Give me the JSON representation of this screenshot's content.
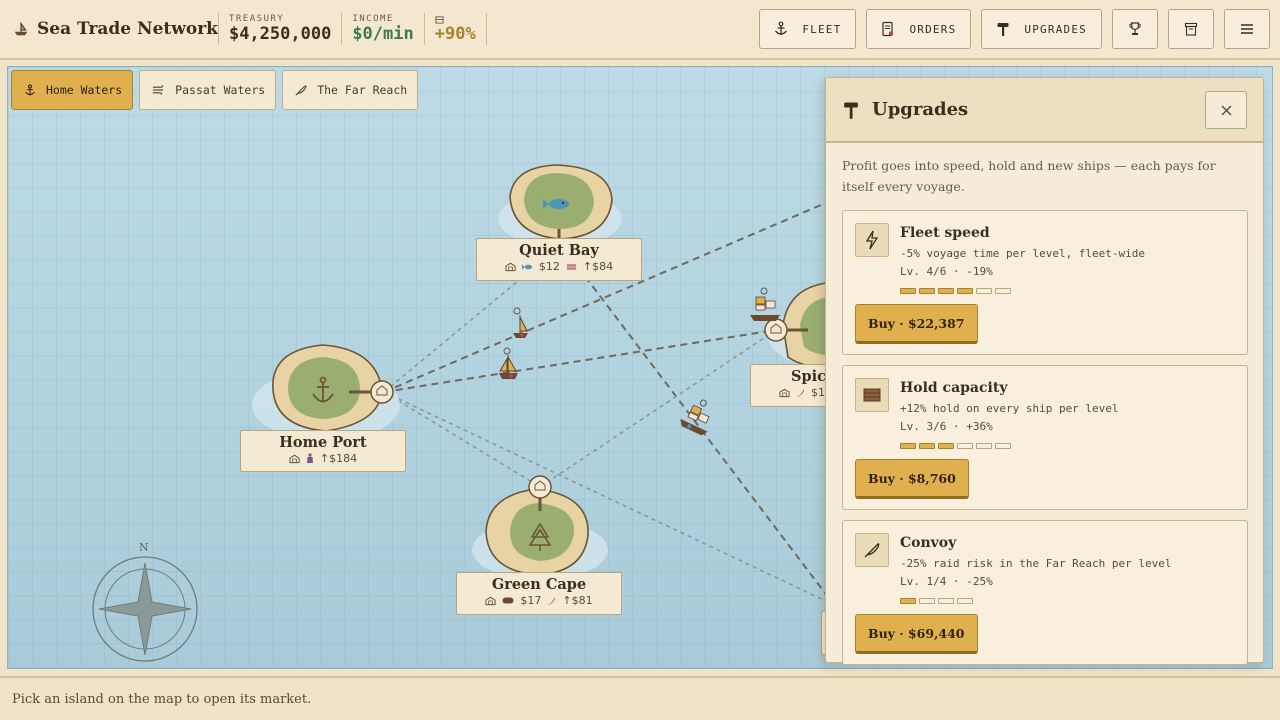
{
  "header": {
    "title": "Sea Trade Network",
    "stats": [
      {
        "label": "TREASURY",
        "value": "$4,250,000",
        "color": "#3a2e1f"
      },
      {
        "label": "INCOME",
        "value": "$0/min",
        "color": "#3f7a4e"
      },
      {
        "label": "",
        "value": "+90%",
        "color": "#a5822f"
      }
    ],
    "nav": {
      "fleet_label": "FLEET",
      "orders_label": "ORDERS",
      "upgrades_label": "UPGRADES"
    }
  },
  "map": {
    "tabs": [
      {
        "label": "Home Waters",
        "icon": "anchor-icon",
        "active": true
      },
      {
        "label": "Passat Waters",
        "icon": "wind-icon",
        "active": false
      },
      {
        "label": "The Far Reach",
        "icon": "feather-icon",
        "active": false
      }
    ],
    "compass_label": "N",
    "islands": [
      {
        "name": "Home Port",
        "icon": "anchor-icon",
        "goods": [
          {
            "icon": "potion-icon",
            "price": "↑$184"
          }
        ]
      },
      {
        "name": "Quiet Bay",
        "icon": "fish-icon",
        "goods": [
          {
            "icon": "fish-icon",
            "price": "$12"
          },
          {
            "icon": "cloth-icon",
            "price": "↑$84"
          }
        ]
      },
      {
        "name": "Green Cape",
        "icon": "pine-tree-icon",
        "goods": [
          {
            "icon": "log-icon",
            "price": "$17"
          },
          {
            "icon": "pepper-icon",
            "price": "↑$81"
          }
        ]
      },
      {
        "name": "Spice",
        "icon": "",
        "goods": [
          {
            "icon": "pepper-icon",
            "price": "$1"
          }
        ]
      }
    ]
  },
  "panel": {
    "title": "Upgrades",
    "intro": "Profit goes into speed, hold and new ships — each pays for itself every voyage.",
    "cards": [
      {
        "title": "Fleet speed",
        "icon": "lightning-icon",
        "desc": "-5% voyage time per level, fleet-wide",
        "level": "Lv. 4/6 · -19%",
        "level_now": 4,
        "level_max": 6,
        "buy": "Buy · $22,387"
      },
      {
        "title": "Hold capacity",
        "icon": "crate-icon",
        "desc": "+12% hold on every ship per level",
        "level": "Lv. 3/6 · +36%",
        "level_now": 3,
        "level_max": 6,
        "buy": "Buy · $8,760"
      },
      {
        "title": "Convoy",
        "icon": "feather-icon",
        "desc": "-25% raid risk in the Far Reach per level",
        "level": "Lv. 1/4 · -25%",
        "level_now": 1,
        "level_max": 4,
        "buy": "Buy · $69,440"
      }
    ]
  },
  "status": {
    "text": "Pick an island on the map to open its market."
  },
  "colors": {
    "accent": "#e0b04f",
    "sea": "#b9d8e3",
    "parchment": "#f4ead3",
    "income_green": "#3f7a4e"
  }
}
